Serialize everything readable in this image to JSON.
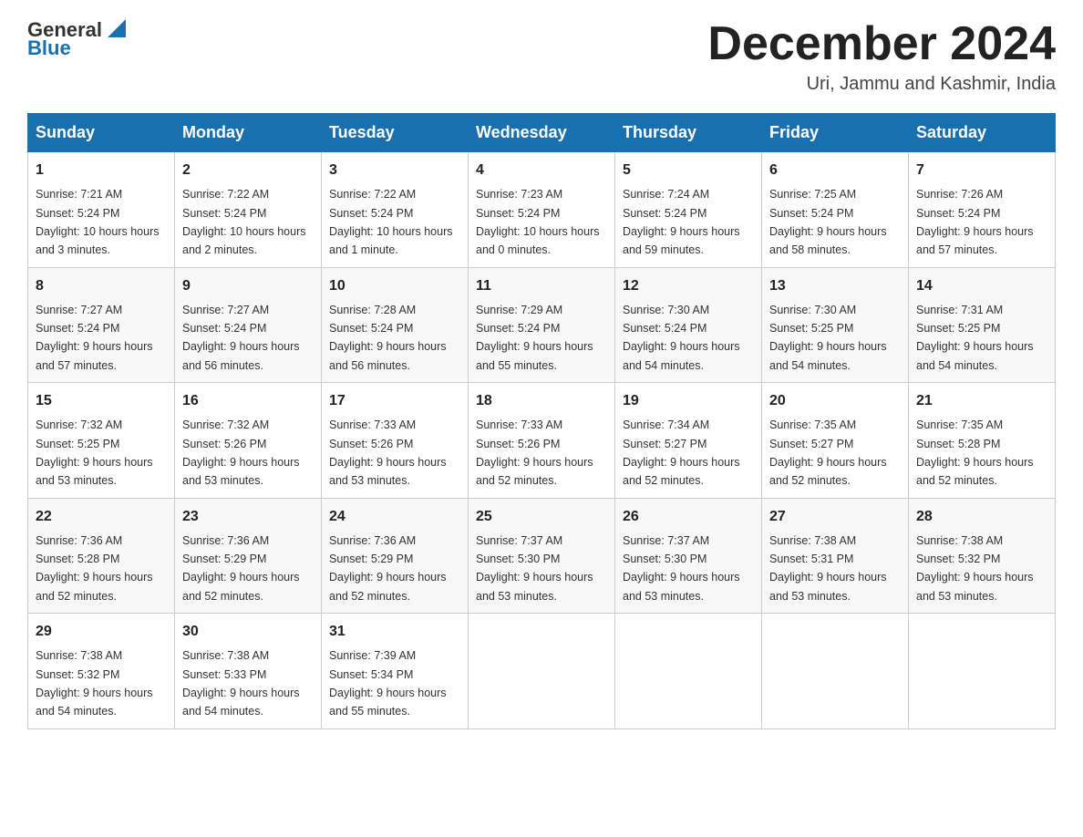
{
  "header": {
    "logo_text_general": "General",
    "logo_text_blue": "Blue",
    "month_title": "December 2024",
    "location": "Uri, Jammu and Kashmir, India"
  },
  "days_of_week": [
    "Sunday",
    "Monday",
    "Tuesday",
    "Wednesday",
    "Thursday",
    "Friday",
    "Saturday"
  ],
  "weeks": [
    [
      {
        "day": "1",
        "sunrise": "7:21 AM",
        "sunset": "5:24 PM",
        "daylight": "10 hours and 3 minutes."
      },
      {
        "day": "2",
        "sunrise": "7:22 AM",
        "sunset": "5:24 PM",
        "daylight": "10 hours and 2 minutes."
      },
      {
        "day": "3",
        "sunrise": "7:22 AM",
        "sunset": "5:24 PM",
        "daylight": "10 hours and 1 minute."
      },
      {
        "day": "4",
        "sunrise": "7:23 AM",
        "sunset": "5:24 PM",
        "daylight": "10 hours and 0 minutes."
      },
      {
        "day": "5",
        "sunrise": "7:24 AM",
        "sunset": "5:24 PM",
        "daylight": "9 hours and 59 minutes."
      },
      {
        "day": "6",
        "sunrise": "7:25 AM",
        "sunset": "5:24 PM",
        "daylight": "9 hours and 58 minutes."
      },
      {
        "day": "7",
        "sunrise": "7:26 AM",
        "sunset": "5:24 PM",
        "daylight": "9 hours and 57 minutes."
      }
    ],
    [
      {
        "day": "8",
        "sunrise": "7:27 AM",
        "sunset": "5:24 PM",
        "daylight": "9 hours and 57 minutes."
      },
      {
        "day": "9",
        "sunrise": "7:27 AM",
        "sunset": "5:24 PM",
        "daylight": "9 hours and 56 minutes."
      },
      {
        "day": "10",
        "sunrise": "7:28 AM",
        "sunset": "5:24 PM",
        "daylight": "9 hours and 56 minutes."
      },
      {
        "day": "11",
        "sunrise": "7:29 AM",
        "sunset": "5:24 PM",
        "daylight": "9 hours and 55 minutes."
      },
      {
        "day": "12",
        "sunrise": "7:30 AM",
        "sunset": "5:24 PM",
        "daylight": "9 hours and 54 minutes."
      },
      {
        "day": "13",
        "sunrise": "7:30 AM",
        "sunset": "5:25 PM",
        "daylight": "9 hours and 54 minutes."
      },
      {
        "day": "14",
        "sunrise": "7:31 AM",
        "sunset": "5:25 PM",
        "daylight": "9 hours and 54 minutes."
      }
    ],
    [
      {
        "day": "15",
        "sunrise": "7:32 AM",
        "sunset": "5:25 PM",
        "daylight": "9 hours and 53 minutes."
      },
      {
        "day": "16",
        "sunrise": "7:32 AM",
        "sunset": "5:26 PM",
        "daylight": "9 hours and 53 minutes."
      },
      {
        "day": "17",
        "sunrise": "7:33 AM",
        "sunset": "5:26 PM",
        "daylight": "9 hours and 53 minutes."
      },
      {
        "day": "18",
        "sunrise": "7:33 AM",
        "sunset": "5:26 PM",
        "daylight": "9 hours and 52 minutes."
      },
      {
        "day": "19",
        "sunrise": "7:34 AM",
        "sunset": "5:27 PM",
        "daylight": "9 hours and 52 minutes."
      },
      {
        "day": "20",
        "sunrise": "7:35 AM",
        "sunset": "5:27 PM",
        "daylight": "9 hours and 52 minutes."
      },
      {
        "day": "21",
        "sunrise": "7:35 AM",
        "sunset": "5:28 PM",
        "daylight": "9 hours and 52 minutes."
      }
    ],
    [
      {
        "day": "22",
        "sunrise": "7:36 AM",
        "sunset": "5:28 PM",
        "daylight": "9 hours and 52 minutes."
      },
      {
        "day": "23",
        "sunrise": "7:36 AM",
        "sunset": "5:29 PM",
        "daylight": "9 hours and 52 minutes."
      },
      {
        "day": "24",
        "sunrise": "7:36 AM",
        "sunset": "5:29 PM",
        "daylight": "9 hours and 52 minutes."
      },
      {
        "day": "25",
        "sunrise": "7:37 AM",
        "sunset": "5:30 PM",
        "daylight": "9 hours and 53 minutes."
      },
      {
        "day": "26",
        "sunrise": "7:37 AM",
        "sunset": "5:30 PM",
        "daylight": "9 hours and 53 minutes."
      },
      {
        "day": "27",
        "sunrise": "7:38 AM",
        "sunset": "5:31 PM",
        "daylight": "9 hours and 53 minutes."
      },
      {
        "day": "28",
        "sunrise": "7:38 AM",
        "sunset": "5:32 PM",
        "daylight": "9 hours and 53 minutes."
      }
    ],
    [
      {
        "day": "29",
        "sunrise": "7:38 AM",
        "sunset": "5:32 PM",
        "daylight": "9 hours and 54 minutes."
      },
      {
        "day": "30",
        "sunrise": "7:38 AM",
        "sunset": "5:33 PM",
        "daylight": "9 hours and 54 minutes."
      },
      {
        "day": "31",
        "sunrise": "7:39 AM",
        "sunset": "5:34 PM",
        "daylight": "9 hours and 55 minutes."
      },
      null,
      null,
      null,
      null
    ]
  ],
  "labels": {
    "sunrise": "Sunrise:",
    "sunset": "Sunset:",
    "daylight": "Daylight:"
  }
}
